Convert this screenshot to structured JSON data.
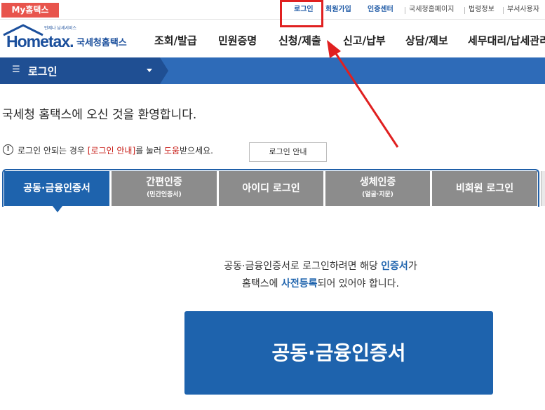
{
  "topbar": {
    "my_hometax": "My홈택스",
    "links": {
      "login": "로그인",
      "signup": "회원가입",
      "cert_center": "인증센터",
      "nts_homepage": "국세청홈페이지",
      "laws": "법령정보",
      "dept_site": "부서사용자"
    }
  },
  "logo": {
    "word": "Hometax.",
    "small": "언제나 납세서비스",
    "kr": "국세청홈택스"
  },
  "gnb": [
    "조회/발급",
    "민원증명",
    "신청/제출",
    "신고/납부",
    "상담/제보",
    "세무대리/납세관리"
  ],
  "bluebar": {
    "menu_icon": "menu-icon",
    "label": "로그인"
  },
  "welcome": "국세청 홈택스에 오신 것을 환영합니다.",
  "notice": {
    "before": "로그인 안되는 경우 ",
    "guide_link": "[로그인 안내]",
    "middle": "를 눌러 ",
    "help": "도움",
    "after": "받으세요.",
    "button": "로그인 안내"
  },
  "tabs": [
    {
      "label": "공동·금융인증서",
      "sub": ""
    },
    {
      "label": "간편인증",
      "sub": "(민간인증서)"
    },
    {
      "label": "아이디 로그인",
      "sub": ""
    },
    {
      "label": "생체인증",
      "sub": "(얼굴·지문)"
    },
    {
      "label": "비회원 로그인",
      "sub": ""
    }
  ],
  "description": {
    "line1_before": "공동·금융인증서로 로그인하려면 해당 ",
    "line1_hl": "인증서",
    "line1_after": "가",
    "line2_before": "홈택스에 ",
    "line2_hl": "사전등록",
    "line2_after": "되어 있어야 합니다."
  },
  "cert_button": "공동·금융인증서",
  "colors": {
    "brand_blue": "#1e63ad",
    "bar_blue": "#2e6bb8",
    "alert_red": "#e8544c",
    "annotation_red": "#e02020",
    "inactive_tab": "#8c8c8c"
  }
}
